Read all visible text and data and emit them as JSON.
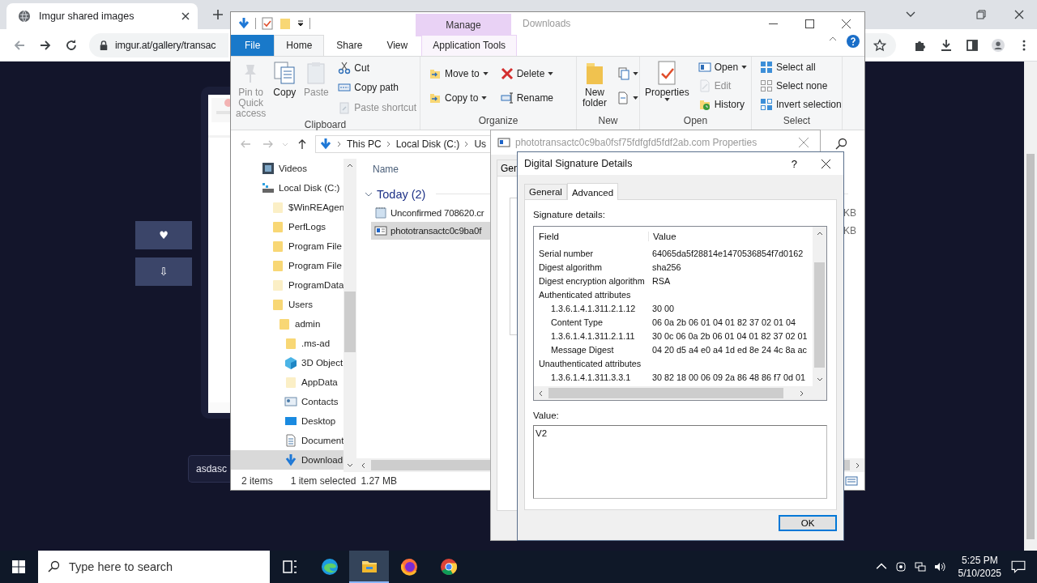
{
  "browser": {
    "tab_title": "Imgur shared images",
    "address": "imgur.at/gallery/transac"
  },
  "page": {
    "buttons": [
      {
        "glyph": "♥"
      },
      {
        "glyph": "⇩"
      }
    ],
    "input_value": "asdasc"
  },
  "explorer": {
    "title": "Downloads",
    "context_tab": "Manage",
    "tabs": [
      {
        "label": "File",
        "kind": "file",
        "selected": false
      },
      {
        "label": "Home",
        "kind": "plain",
        "selected": true
      },
      {
        "label": "Share",
        "kind": "plain",
        "selected": false
      },
      {
        "label": "View",
        "kind": "plain",
        "selected": false
      },
      {
        "label": "Application Tools",
        "kind": "context",
        "selected": false
      }
    ],
    "ribbon": [
      {
        "label": "Clipboard",
        "large": [
          {
            "label": "Pin to Quick access",
            "kind": "pin",
            "disabled": true,
            "dropdown": false
          },
          {
            "label": "Copy",
            "kind": "copy",
            "disabled": false,
            "dropdown": false
          },
          {
            "label": "Paste",
            "kind": "paste",
            "disabled": true,
            "dropdown": false
          }
        ],
        "small": [
          [
            {
              "label": "Cut",
              "kind": "cut",
              "disabled": false,
              "dropdown": false
            },
            {
              "label": "Copy path",
              "kind": "copypath",
              "disabled": false,
              "dropdown": false
            },
            {
              "label": "Paste shortcut",
              "kind": "pasteshortcut",
              "disabled": true,
              "dropdown": false
            }
          ]
        ]
      },
      {
        "label": "Organize",
        "small": [
          [
            {
              "label": "Move to",
              "kind": "moveto",
              "disabled": false,
              "dropdown": true
            },
            {
              "label": "Copy to",
              "kind": "copyto",
              "disabled": false,
              "dropdown": true
            }
          ],
          [
            {
              "label": "Delete",
              "kind": "delete",
              "disabled": false,
              "dropdown": true
            },
            {
              "label": "Rename",
              "kind": "rename",
              "disabled": false,
              "dropdown": false
            }
          ]
        ]
      },
      {
        "label": "New",
        "large": [
          {
            "label": "New folder",
            "kind": "newfolder",
            "disabled": false,
            "dropdown": false
          }
        ],
        "small": [
          [
            {
              "kind": "newitem",
              "disabled": false,
              "dropdown": true
            },
            {
              "kind": "easyaccess",
              "disabled": false,
              "dropdown": true
            }
          ]
        ]
      },
      {
        "label": "Open",
        "large": [
          {
            "label": "Properties",
            "kind": "properties",
            "disabled": false,
            "dropdown": true
          }
        ],
        "small": [
          [
            {
              "label": "Open",
              "kind": "open",
              "disabled": false,
              "dropdown": true
            },
            {
              "label": "Edit",
              "kind": "edit",
              "disabled": true,
              "dropdown": false
            },
            {
              "label": "History",
              "kind": "history",
              "disabled": false,
              "dropdown": false
            }
          ]
        ]
      },
      {
        "label": "Select",
        "small": [
          [
            {
              "label": "Select all",
              "kind": "selectall",
              "disabled": false,
              "dropdown": false
            },
            {
              "label": "Select none",
              "kind": "selectnone",
              "disabled": false,
              "dropdown": false
            },
            {
              "label": "Invert selection",
              "kind": "invert",
              "disabled": false,
              "dropdown": false
            }
          ]
        ]
      }
    ],
    "breadcrumbs": [
      "This PC",
      "Local Disk (C:)",
      "Us"
    ],
    "nav": [
      {
        "label": "Videos",
        "kind": "videos",
        "selected": false
      },
      {
        "label": "Local Disk (C:)",
        "kind": "drive",
        "selected": false,
        "children": [
          {
            "label": "$WinREAgen",
            "kind": "folder-pale",
            "selected": false
          },
          {
            "label": "PerfLogs",
            "kind": "folder",
            "selected": false
          },
          {
            "label": "Program File",
            "kind": "folder",
            "selected": false
          },
          {
            "label": "Program File",
            "kind": "folder",
            "selected": false
          },
          {
            "label": "ProgramData",
            "kind": "folder-pale",
            "selected": false
          },
          {
            "label": "Users",
            "kind": "folder",
            "selected": false,
            "children": [
              {
                "label": "admin",
                "kind": "folder",
                "selected": false,
                "children": [
                  {
                    "label": ".ms-ad",
                    "kind": "folder",
                    "selected": false
                  },
                  {
                    "label": "3D Object",
                    "kind": "cube",
                    "selected": false
                  },
                  {
                    "label": "AppData",
                    "kind": "folder-pale",
                    "selected": false
                  },
                  {
                    "label": "Contacts",
                    "kind": "contacts",
                    "selected": false
                  },
                  {
                    "label": "Desktop",
                    "kind": "desktop",
                    "selected": false
                  },
                  {
                    "label": "Document",
                    "kind": "document",
                    "selected": false
                  },
                  {
                    "label": "Download",
                    "kind": "download",
                    "selected": true
                  }
                ]
              }
            ]
          }
        ]
      }
    ],
    "column": "Name",
    "group": "Today (2)",
    "files": [
      {
        "name": "Unconfirmed 708620.cr",
        "kind": "text",
        "size": "KB",
        "selected": false
      },
      {
        "name": "phototransactc0c9ba0f",
        "kind": "app",
        "size": "KB",
        "selected": true
      }
    ],
    "status": {
      "count": "2 items",
      "selection": "1 item selected",
      "size": "1.27 MB"
    }
  },
  "properties": {
    "title": "phototransactc0c9ba0fsf75fdfgfd5fdf2ab.com Properties",
    "tab": "Gen"
  },
  "signature": {
    "title": "Digital Signature Details",
    "help": "?",
    "tabs": [
      {
        "label": "General",
        "selected": false
      },
      {
        "label": "Advanced",
        "selected": true
      }
    ],
    "details_label": "Signature details:",
    "columns": [
      "Field",
      "Value"
    ],
    "rows": [
      {
        "field": "Serial number",
        "value": "64065da5f28814e1470536854f7d0162"
      },
      {
        "field": "Digest algorithm",
        "value": "sha256"
      },
      {
        "field": "Digest encryption algorithm",
        "value": "RSA"
      },
      {
        "field": "Authenticated attributes",
        "children": [
          {
            "field": "1.3.6.1.4.1.311.2.1.12",
            "value": "30 00"
          },
          {
            "field": "Content Type",
            "value": "06 0a 2b 06 01 04 01 82 37 02 01 04"
          },
          {
            "field": "1.3.6.1.4.1.311.2.1.11",
            "value": "30 0c 06 0a 2b 06 01 04 01 82 37 02 01"
          },
          {
            "field": "Message Digest",
            "value": "04 20 d5 a4 e0 a4 1d ed 8e 24 4c 8a ac"
          }
        ]
      },
      {
        "field": "Unauthenticated attributes",
        "children": [
          {
            "field": "1.3.6.1.4.1.311.3.3.1",
            "value": "30 82 18 00 06 09 2a 86 48 86 f7 0d 01"
          }
        ]
      }
    ],
    "value_label": "Value:",
    "value": "V2",
    "ok": "OK"
  },
  "taskbar": {
    "search_placeholder": "Type here to search",
    "apps": [
      {
        "kind": "taskview",
        "active": false
      },
      {
        "kind": "edge",
        "active": false
      },
      {
        "kind": "explorer",
        "active": true
      },
      {
        "kind": "firefox",
        "active": false
      },
      {
        "kind": "chrome",
        "active": false
      }
    ],
    "time": "5:25 PM",
    "date": "5/10/2025"
  }
}
